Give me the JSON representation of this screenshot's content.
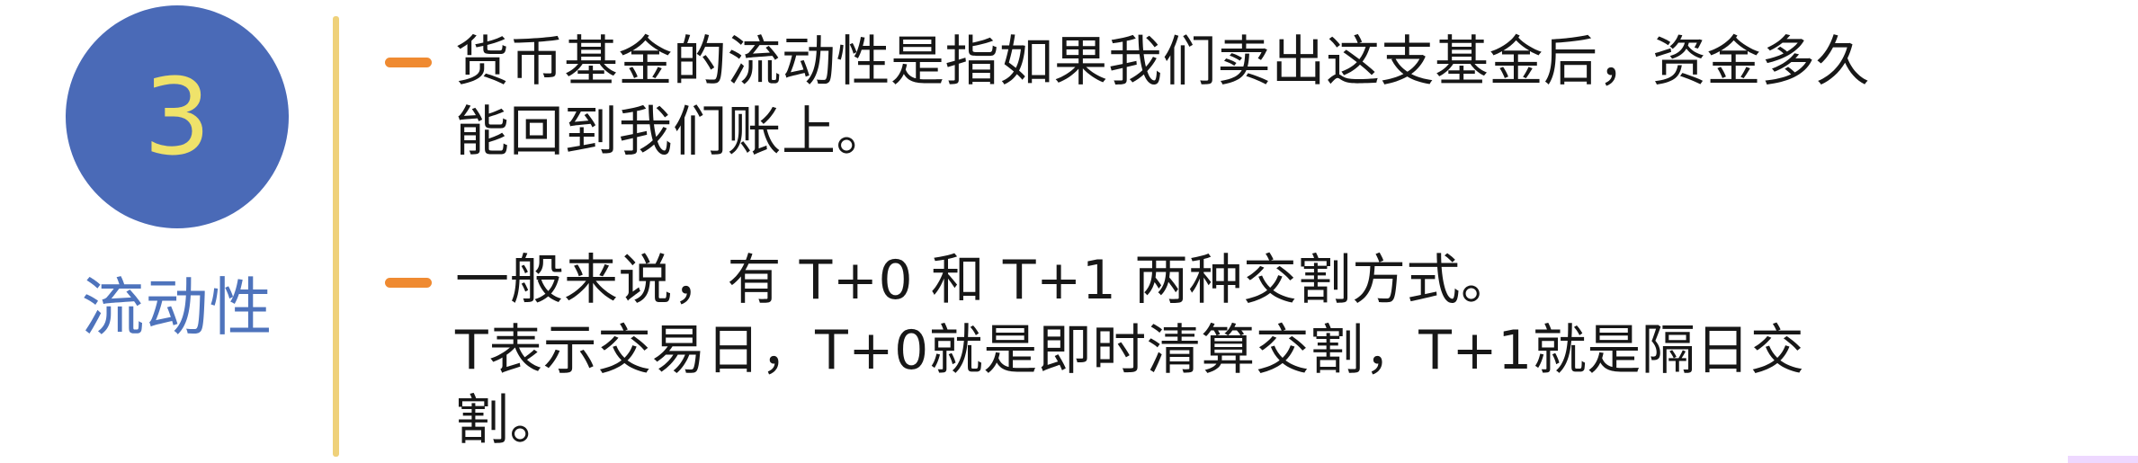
{
  "badge": {
    "number": "3"
  },
  "topic": {
    "label": "流动性"
  },
  "items": [
    {
      "lines": [
        "货币基金的流动性是指如果我们卖出这支基金后，资金多久",
        "能回到我们账上。"
      ]
    },
    {
      "lines": [
        "一般来说，有 T+0 和 T+1 两种交割方式。",
        "T表示交易日，T+0就是即时清算交割，T+1就是隔日交",
        "割。"
      ]
    }
  ],
  "colors": {
    "badge_bg": "#4a6ab7",
    "badge_number": "#efe26a",
    "topic_label": "#4e73bc",
    "divider": "#efd17a",
    "bullet": "#ef8a31",
    "text": "#171717"
  }
}
